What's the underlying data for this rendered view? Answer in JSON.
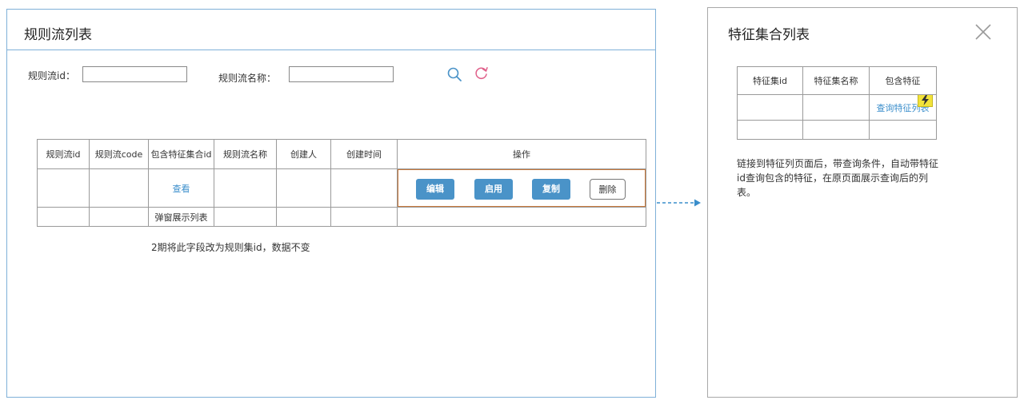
{
  "left_panel": {
    "title": "规则流列表",
    "filters": {
      "rule_flow_id_label": "规则流id：",
      "rule_flow_id_value": "",
      "rule_flow_name_label": "规则流名称：",
      "rule_flow_name_value": ""
    },
    "icons": {
      "search": "search-icon",
      "refresh": "refresh-icon"
    },
    "table": {
      "headers": [
        "规则流id",
        "规则流code",
        "包含特征集合id",
        "规则流名称",
        "创建人",
        "创建时间",
        "操作"
      ],
      "row1": {
        "view_link": "查看"
      },
      "row2": {
        "popup_note": "弹窗展示列表"
      },
      "actions": {
        "edit": "编辑",
        "enable": "启用",
        "copy": "复制",
        "delete": "删除"
      }
    },
    "note": "2期将此字段改为规则集id，数据不变"
  },
  "right_panel": {
    "title": "特征集合列表",
    "close_icon": "close-icon",
    "table": {
      "headers": [
        "特征集id",
        "特征集名称",
        "包含特征"
      ],
      "row1": {
        "query_link": "查询特征列表"
      }
    },
    "badge_icon": "lightning-icon",
    "note": "链接到特征列页面后，带查询条件，自动带特征id查询包含的特征，在原页面展示查询后的列表。"
  },
  "colors": {
    "primary_button": "#4a93c8",
    "link": "#3a8ecb",
    "highlight_border": "#c97a3c",
    "panel_border": "#7fb0d8",
    "refresh_icon": "#e0608a",
    "badge": "#f2e33a"
  }
}
